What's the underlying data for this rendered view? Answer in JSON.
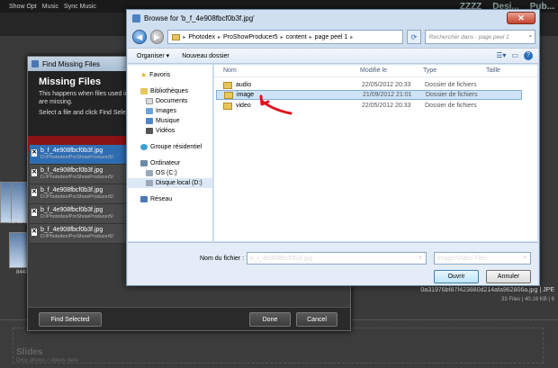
{
  "app": {
    "menu": [
      "Show Opt",
      "Music",
      "Sync Music"
    ],
    "top_right": [
      "ZZZZ",
      "Desi...",
      "Pub..."
    ],
    "thumbs": [
      "23-11-2",
      "8443"
    ],
    "file_info": {
      "name": "0a31976bf87f423880d214afa962806a.jpg",
      "suffix": "JPE",
      "files": "33 Files",
      "size": "40.16 KB",
      "dims": "6"
    },
    "slides": {
      "title": "Slides",
      "subtitle": "Drop photos / videos here"
    }
  },
  "find_missing": {
    "window_title": "Find Missing Files",
    "heading": "Missing Files",
    "description": "This happens when files used in y...\nare missing.",
    "instruction": "Select a file and click Find Selecte...",
    "files": [
      {
        "name": "b_f_4e908fbcf0b3f.jpg",
        "path": "D:/Photodex/ProShowProducer5/"
      },
      {
        "name": "b_f_4e908fbcf0b3f.jpg",
        "path": "D:/Photodex/ProShowProducer5/"
      },
      {
        "name": "b_f_4e908fbcf0b3f.jpg",
        "path": "D:/Photodex/ProShowProducer5/"
      },
      {
        "name": "b_f_4e908fbcf0b3f.jpg",
        "path": "D:/Photodex/ProShowProducer5/"
      },
      {
        "name": "b_f_4e908fbcf0b3f.jpg",
        "path": "D:/Photodex/ProShowProducer5/"
      }
    ],
    "buttons": {
      "find_selected": "Find Selected",
      "done": "Done",
      "cancel": "Cancel"
    }
  },
  "browse": {
    "title": "Browse for 'b_f_4e908fbcf0b3f.jpg'",
    "breadcrumb": [
      "Photodex",
      "ProShowProducer5",
      "content",
      "page peel 1"
    ],
    "search_placeholder": "Rechercher dans : page peel 1",
    "toolbar": {
      "organize": "Organiser ▾",
      "new_folder": "Nouveau dossier"
    },
    "nav": {
      "favorites": "Favoris",
      "libraries": "Bibliothèques",
      "lib_items": [
        "Documents",
        "Images",
        "Musique",
        "Vidéos"
      ],
      "homegroup": "Groupe résidentiel",
      "computer": "Ordinateur",
      "drives": [
        "OS (C:)",
        "Disque local (D:)"
      ],
      "network": "Réseau"
    },
    "columns": {
      "name": "Nom",
      "modified": "Modifié le",
      "type": "Type",
      "size": "Taille"
    },
    "files": [
      {
        "name": "audio",
        "modified": "22/05/2012 20:33",
        "type": "Dossier de fichiers"
      },
      {
        "name": "image",
        "modified": "21/09/2012 21:01",
        "type": "Dossier de fichiers"
      },
      {
        "name": "video",
        "modified": "22/05/2012 20:33",
        "type": "Dossier de fichiers"
      }
    ],
    "filename_label": "Nom du fichier :",
    "filename_value": "b_f_4e908fbcf0b3f.jpg",
    "filetype": "Image/Video Files",
    "buttons": {
      "open": "Ouvrir",
      "cancel": "Annuler"
    }
  },
  "colors": {
    "accent_red": "#8a1414",
    "selection_blue": "#2f6db3",
    "annotation_red": "#e0141e"
  }
}
